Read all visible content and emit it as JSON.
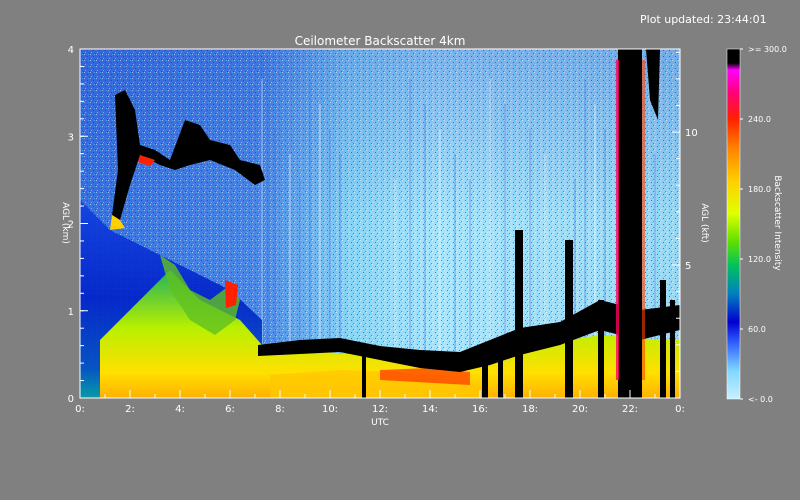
{
  "plot_updated": "Plot updated: 23:44:01",
  "chart_data": {
    "type": "heatmap",
    "title": "Ceilometer Backscatter 4km",
    "xlabel": "UTC",
    "ylabel": "AGL (km)",
    "ylabel_right": "AGL (kft)",
    "x_range": [
      0,
      24
    ],
    "y_range": [
      0,
      4
    ],
    "x_ticks": [
      "0:",
      "2:",
      "4:",
      "6:",
      "8:",
      "10:",
      "12:",
      "14:",
      "16:",
      "18:",
      "20:",
      "22:",
      "0:"
    ],
    "y_ticks": [
      "0",
      "1",
      "2",
      "3",
      "4"
    ],
    "y_ticks_right": [
      "5",
      "10"
    ],
    "y_ticks_right_values_kft": [
      5,
      10
    ],
    "colorbar": {
      "label": "Backscatter Intensity",
      "range": [
        0,
        300
      ],
      "tick_labels": [
        "<- 0.0",
        "60.0",
        "120.0",
        "180.0",
        "240.0",
        ">= 300.0"
      ],
      "colors": [
        "#c8f0ff",
        "#80d8ff",
        "#3060ff",
        "#0000d0",
        "#0080c0",
        "#00c060",
        "#60e000",
        "#e0ff00",
        "#ffd000",
        "#ff8000",
        "#ff2000",
        "#ff0080",
        "#ff00ff",
        "#000000"
      ]
    },
    "features": {
      "boundary_layer_top_km": [
        [
          0,
          1.4
        ],
        [
          2,
          1.2
        ],
        [
          4,
          1.0
        ],
        [
          6,
          0.8
        ],
        [
          7.4,
          0.55
        ],
        [
          10,
          0.55
        ],
        [
          12,
          0.45
        ],
        [
          14,
          0.4
        ],
        [
          16,
          0.45
        ],
        [
          18,
          0.55
        ],
        [
          20,
          0.65
        ],
        [
          22,
          0.7
        ],
        [
          24,
          0.7
        ]
      ],
      "cloud_layer_km": [
        [
          1.5,
          2.9
        ],
        [
          3,
          2.75
        ],
        [
          4,
          3.0
        ],
        [
          5,
          2.85
        ],
        [
          6,
          2.7
        ],
        [
          7,
          2.5
        ],
        [
          8,
          2.5
        ]
      ],
      "precip_column_utc": [
        21.8,
        22.8
      ]
    }
  }
}
